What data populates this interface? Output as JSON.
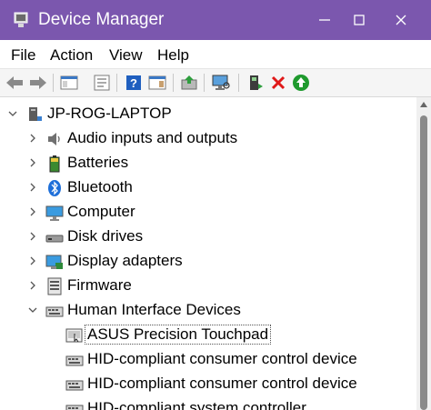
{
  "window": {
    "title": "Device Manager",
    "title_bar_color": "#7b57ae",
    "controls": [
      "minimize-icon",
      "maximize-icon",
      "close-icon"
    ]
  },
  "menu": [
    "File",
    "Action",
    "View",
    "Help"
  ],
  "toolbar": {
    "buttons": [
      "back-arrow-icon",
      "forward-arrow-icon",
      "console-tree-icon",
      "properties-icon",
      "help-icon",
      "action-pane-icon",
      "update-driver-icon",
      "scan-hardware-icon",
      "enable-device-icon",
      "uninstall-device-icon",
      "enable-green-icon"
    ]
  },
  "tree": {
    "root": "JP-ROG-LAPTOP",
    "categories": [
      {
        "label": "Audio inputs and outputs",
        "icon": "speaker-icon",
        "expanded": false
      },
      {
        "label": "Batteries",
        "icon": "battery-icon",
        "expanded": false
      },
      {
        "label": "Bluetooth",
        "icon": "bluetooth-icon",
        "expanded": false
      },
      {
        "label": "Computer",
        "icon": "monitor-icon",
        "expanded": false
      },
      {
        "label": "Disk drives",
        "icon": "disk-drive-icon",
        "expanded": false
      },
      {
        "label": "Display adapters",
        "icon": "display-adapter-icon",
        "expanded": false
      },
      {
        "label": "Firmware",
        "icon": "firmware-icon",
        "expanded": false
      },
      {
        "label": "Human Interface Devices",
        "icon": "hid-icon",
        "expanded": true,
        "children": [
          {
            "label": "ASUS Precision Touchpad",
            "selected": true
          },
          {
            "label": "HID-compliant consumer control device"
          },
          {
            "label": "HID-compliant consumer control device"
          },
          {
            "label": "HID-compliant system controller"
          }
        ]
      }
    ]
  }
}
